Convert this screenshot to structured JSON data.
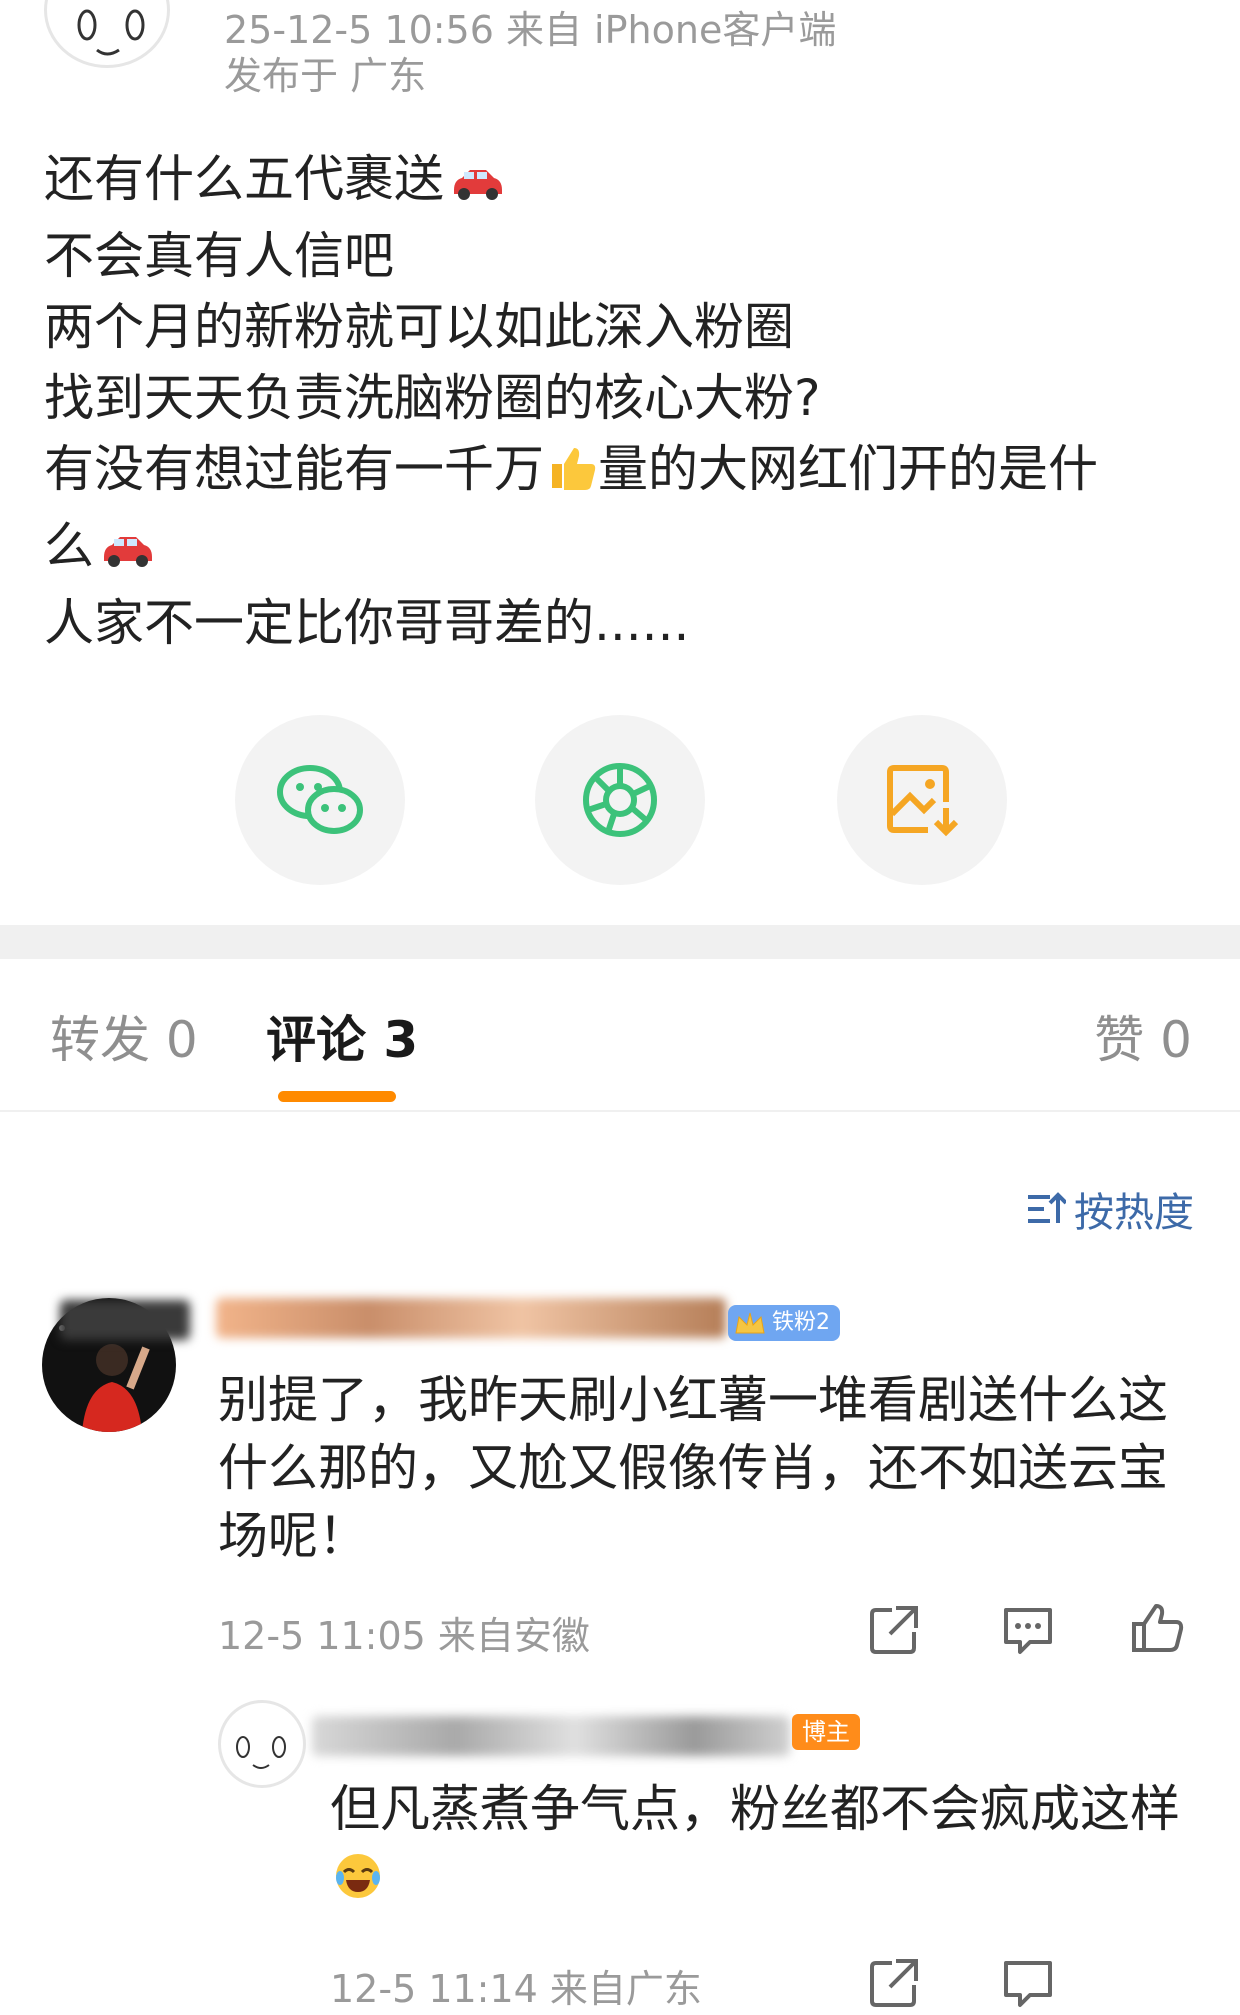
{
  "post": {
    "meta_time_source": "25-12-5 10:56   来自 iPhone客户端",
    "meta_location": "发布于 广东",
    "lines": [
      "还有什么五代裹送",
      "不会真有人信吧",
      "两个月的新粉就可以如此深入粉圈",
      "找到天天负责洗脑粉圈的核心大粉?",
      "有没有想过能有一千万",
      "量的大网红们开的是什",
      "么",
      "人家不一定比你哥哥差的......"
    ]
  },
  "share": {
    "wechat_icon": "wechat-icon",
    "moments_icon": "moments-icon",
    "save_image_icon": "save-image-icon"
  },
  "tabs": {
    "repost": "转发 0",
    "comments": "评论 3",
    "likes": "赞 0",
    "sort": "按热度"
  },
  "comment1": {
    "badge": "铁粉2",
    "text": "别提了，我昨天刷小红薯一堆看剧送什么这什么那的，又尬又假像传肖，还不如送云宝场呢！",
    "time": "12-5 11:05  来自安徽"
  },
  "reply1": {
    "badge": "博主",
    "text": "但凡蒸煮争气点，粉丝都不会疯成这样",
    "time": "12-5 11:14  来自广东"
  },
  "colors": {
    "accent_orange": "#ff8a00",
    "sort_blue": "#3d6aa8",
    "wechat_green": "#3cc27a",
    "save_orange": "#f5a623"
  }
}
